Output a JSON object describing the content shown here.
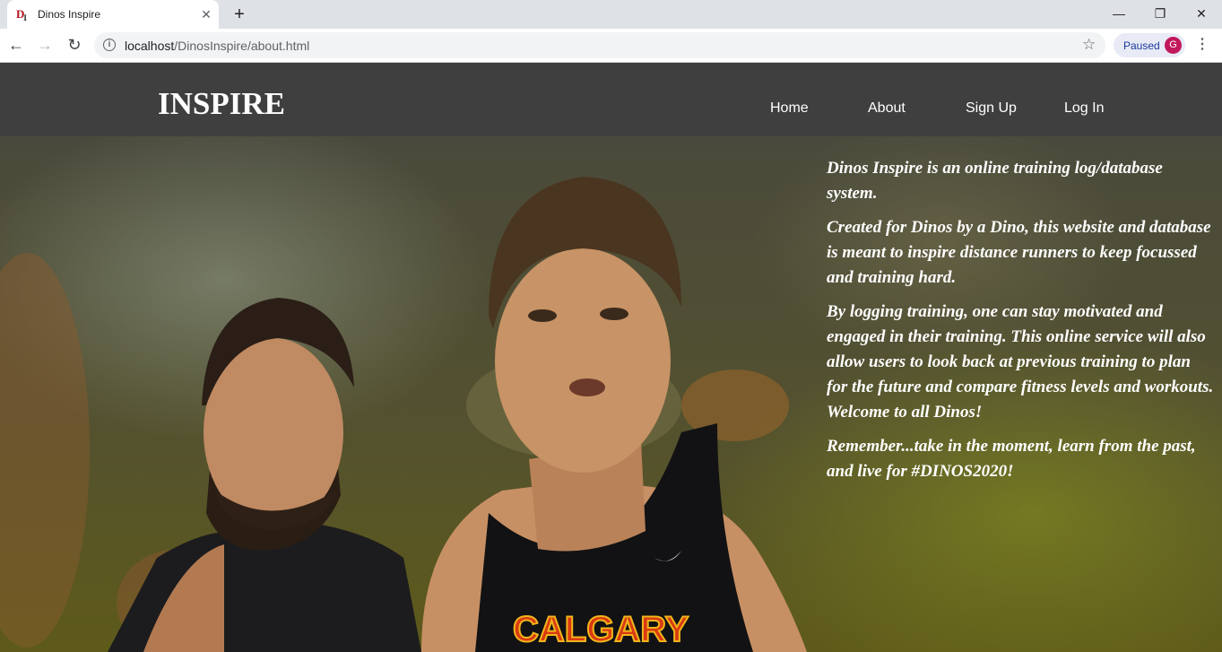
{
  "browser": {
    "tab": {
      "favicon_text": "DI",
      "title": "Dinos Inspire",
      "close_icon": "close-icon"
    },
    "new_tab_icon": "plus-icon",
    "window_controls": [
      "minimize-icon",
      "restore-icon",
      "close-icon"
    ],
    "address_bar": {
      "host": "localhost",
      "path": "/DinosInspire/about.html"
    },
    "profile": {
      "status": "Paused",
      "initial": "G",
      "color": "#c2185b"
    }
  },
  "site": {
    "brand": "INSPIRE",
    "nav": [
      {
        "label": "Home"
      },
      {
        "label": "About"
      },
      {
        "label": "Sign Up"
      },
      {
        "label": "Log In"
      }
    ],
    "header_color": "#3f3f3f"
  },
  "about": {
    "paragraphs": [
      "Dinos Inspire is an online training log/database system.",
      "Created for Dinos by a Dino, this website and database is meant to inspire distance runners to keep focussed and training hard.",
      "By logging training, one can stay motivated and engaged in their training. This online service will also allow users to look back at previous training to plan for the future and compare fitness levels and workouts. Welcome to all Dinos!",
      "Remember...take in the moment, learn from the past, and live for #DINOS2020!"
    ]
  },
  "hero_image": {
    "jersey_text": "CALGARY"
  }
}
